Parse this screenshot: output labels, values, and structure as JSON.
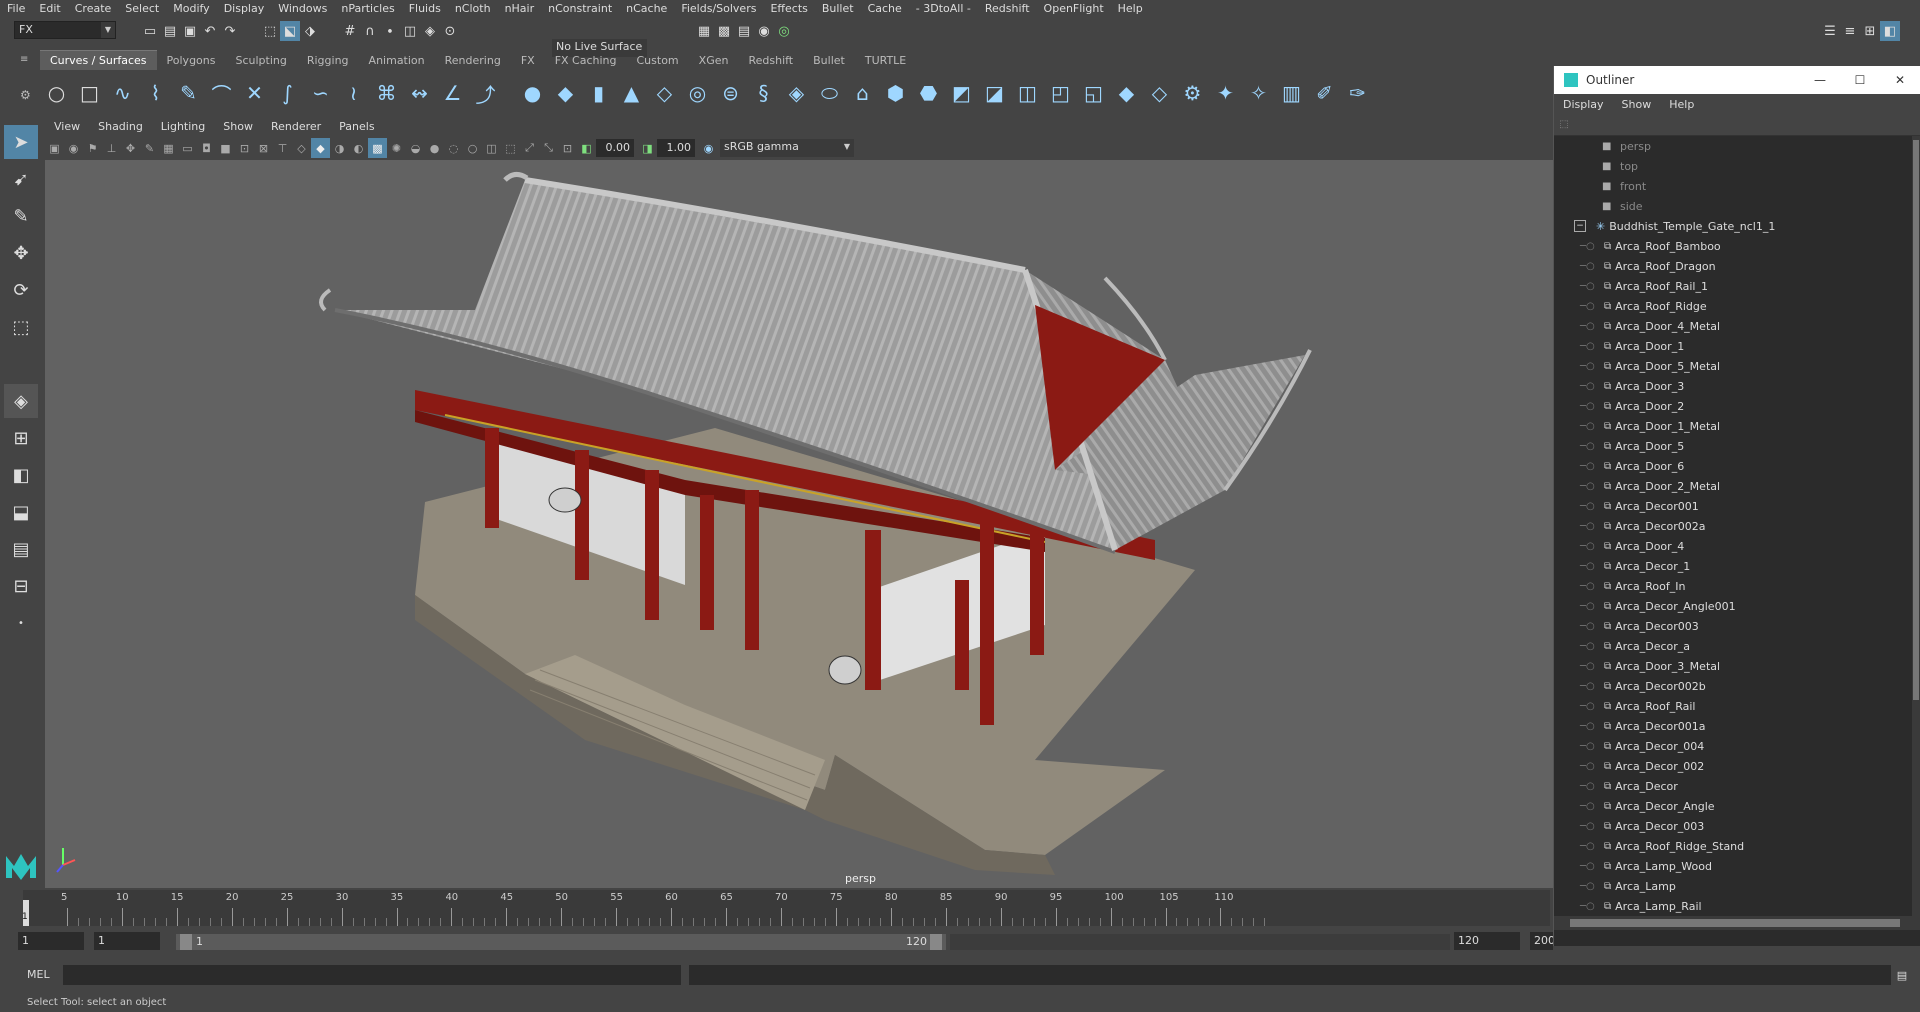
{
  "menubar": [
    "File",
    "Edit",
    "Create",
    "Select",
    "Modify",
    "Display",
    "Windows",
    "nParticles",
    "Fluids",
    "nCloth",
    "nHair",
    "nConstraint",
    "nCache",
    "Fields/Solvers",
    "Effects",
    "Bullet",
    "Cache",
    "- 3DtoAll -",
    "Redshift",
    "OpenFlight",
    "Help"
  ],
  "status": {
    "menuset": "FX",
    "live_surface": "No Live Surface"
  },
  "shelf_tabs": [
    "Curves / Surfaces",
    "Polygons",
    "Sculpting",
    "Rigging",
    "Animation",
    "Rendering",
    "FX",
    "FX Caching",
    "Custom",
    "XGen",
    "Redshift",
    "Bullet",
    "TURTLE"
  ],
  "shelf_active": "Curves / Surfaces",
  "viewport": {
    "menu": [
      "View",
      "Shading",
      "Lighting",
      "Show",
      "Renderer",
      "Panels"
    ],
    "exposure": "0.00",
    "gamma": "1.00",
    "colorspace": "sRGB gamma",
    "camera_label": "persp"
  },
  "timeline": {
    "ticks": [
      "5",
      "10",
      "15",
      "20",
      "25",
      "30",
      "35",
      "40",
      "45",
      "50",
      "55",
      "60",
      "65",
      "70",
      "75",
      "80",
      "85",
      "90",
      "95",
      "100",
      "105",
      "110"
    ],
    "current_frame": "1"
  },
  "range": {
    "start": "1",
    "anim_start": "1",
    "slider_start": "1",
    "slider_end": "120",
    "end": "120",
    "anim_end": "200"
  },
  "command": {
    "label": "MEL"
  },
  "helpline": "Select Tool: select an object",
  "outliner": {
    "title": "Outliner",
    "menu": [
      "Display",
      "Show",
      "Help"
    ],
    "cameras": [
      "persp",
      "top",
      "front",
      "side"
    ],
    "group": "Buddhist_Temple_Gate_ncl1_1",
    "items": [
      "Arca_Roof_Bamboo",
      "Arca_Roof_Dragon",
      "Arca_Roof_Rail_1",
      "Arca_Roof_Ridge",
      "Arca_Door_4_Metal",
      "Arca_Door_1",
      "Arca_Door_5_Metal",
      "Arca_Door_3",
      "Arca_Door_2",
      "Arca_Door_1_Metal",
      "Arca_Door_5",
      "Arca_Door_6",
      "Arca_Door_2_Metal",
      "Arca_Decor001",
      "Arca_Decor002a",
      "Arca_Door_4",
      "Arca_Decor_1",
      "Arca_Roof_In",
      "Arca_Decor_Angle001",
      "Arca_Decor003",
      "Arca_Decor_a",
      "Arca_Door_3_Metal",
      "Arca_Decor002b",
      "Arca_Roof_Rail",
      "Arca_Decor001a",
      "Arca_Decor_004",
      "Arca_Decor_002",
      "Arca_Decor",
      "Arca_Decor_Angle",
      "Arca_Decor_003",
      "Arca_Roof_Ridge_Stand",
      "Arca_Lamp_Wood",
      "Arca_Lamp",
      "Arca_Lamp_Rail"
    ]
  },
  "colors": {
    "accent": "#5285a6",
    "panel": "#444444",
    "viewport": "#626262",
    "roof": "#9a9a9a",
    "wood": "#8b1a14"
  }
}
